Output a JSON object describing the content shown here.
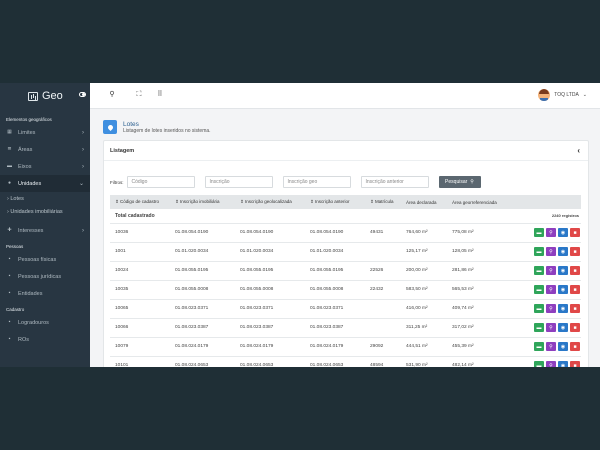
{
  "brand": "Geo",
  "sidebar": {
    "section1": "Elementos geográficos",
    "items1": [
      {
        "label": "Limites",
        "icon": "map-icon"
      },
      {
        "label": "Áreas",
        "icon": "layers-icon"
      },
      {
        "label": "Eixos",
        "icon": "axis-icon"
      },
      {
        "label": "Unidades",
        "icon": "pin-icon"
      }
    ],
    "sub": [
      "› Lotes",
      "› Unidades imobiliárias"
    ],
    "interesses": "Interesses",
    "section2": "Pessoas",
    "items2": [
      "Pessoas físicas",
      "Pessoas jurídicas",
      "Entidades"
    ],
    "section3": "Cadastro",
    "items3": [
      "Logradouros",
      "ROs"
    ]
  },
  "topbar": {
    "user": "TOQ LTDA"
  },
  "page": {
    "title": "Lotes",
    "subtitle": "Listagem de lotes inseridos no sistema."
  },
  "card": {
    "title": "Listagem"
  },
  "filters": {
    "label": "Filtros:",
    "placeholders": [
      "Código",
      "Inscrição",
      "Inscrição geo",
      "Inscrição anterior"
    ],
    "search_label": "Pesquisar"
  },
  "table": {
    "headers": [
      "Código de cadastro",
      "Inscrição imobiliária",
      "Inscrição geolocalizada",
      "Inscrição anterior",
      "Matrícula",
      "Área declarada",
      "Área georreferenciada",
      ""
    ],
    "total_label": "Total cadastrado",
    "total_count": "2240 registros",
    "rows": [
      [
        "10036",
        "01.08.054.0190",
        "01.08.054.0190",
        "01.08.054.0190",
        "49431",
        "764,60 m²",
        "775,08 m²"
      ],
      [
        "1001",
        "01.01.020.0034",
        "01.01.020.0034",
        "01.01.020.0034",
        "",
        "125,17 m²",
        "128,05 m²"
      ],
      [
        "10024",
        "01.08.055.0195",
        "01.08.055.0195",
        "01.08.055.0195",
        "22526",
        "200,00 m²",
        "281,86 m²"
      ],
      [
        "10035",
        "01.08.055.0008",
        "01.08.055.0008",
        "01.08.055.0008",
        "22432",
        "583,50 m²",
        "565,53 m²"
      ],
      [
        "10065",
        "01.08.023.0371",
        "01.08.023.0371",
        "01.08.023.0371",
        "",
        "416,00 m²",
        "409,74 m²"
      ],
      [
        "10066",
        "01.08.023.0387",
        "01.08.023.0387",
        "01.08.023.0387",
        "",
        "311,25 m²",
        "317,02 m²"
      ],
      [
        "10079",
        "01.08.024.0179",
        "01.08.024.0179",
        "01.08.024.0179",
        "29092",
        "444,51 m²",
        "455,39 m²"
      ],
      [
        "10101",
        "01.08.024.0653",
        "01.08.024.0653",
        "01.08.024.0653",
        "48594",
        "531,90 m²",
        "482,14 m²"
      ]
    ]
  }
}
